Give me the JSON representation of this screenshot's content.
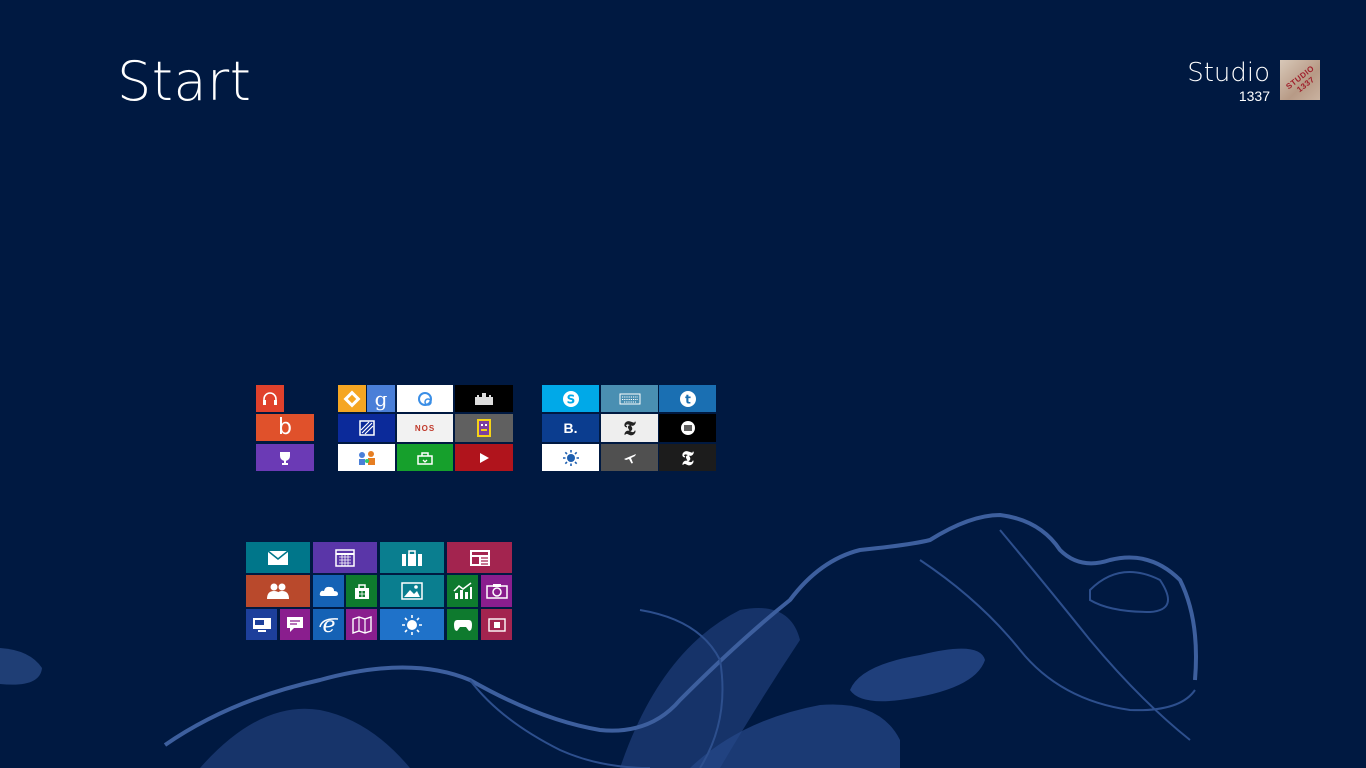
{
  "start": {
    "title": "Start"
  },
  "user": {
    "name": "Studio",
    "sub": "1337",
    "avatar_text": "STUDIO 1337"
  },
  "tile_glyphs": {
    "bing": "b",
    "gmail": "g",
    "booking": "B.",
    "nyt": "𝕿",
    "tumblr": "t",
    "nos": "NOS"
  },
  "colors": {
    "background": "#001941",
    "accent_wave": "#3d5f9e",
    "music": "#e0412c",
    "bing": "#e0512b",
    "games_hub": "#6b3ab5",
    "mail": "#00768a",
    "people": "#b9492c",
    "xbox": "#0e7a2e",
    "youtube": "#b0141c"
  },
  "icons": [
    "headphones-icon",
    "bing-icon",
    "trophy-icon",
    "google-maps-icon",
    "google-icon",
    "circle-icon",
    "castle-icon",
    "stripe-icon",
    "nos-icon",
    "robot-icon",
    "family-icon",
    "store-bag-icon",
    "play-icon",
    "skype-icon",
    "keyboard-icon",
    "tumblr-icon",
    "booking-icon",
    "nyt-icon",
    "news-circle-icon",
    "sun-icon",
    "plane-icon",
    "mail-icon",
    "calendar-icon",
    "travel-icon",
    "news-icon",
    "people-icon",
    "cloud-icon",
    "store-icon",
    "photos-icon",
    "finance-icon",
    "camera-icon",
    "desktop-icon",
    "messaging-icon",
    "ie-icon",
    "maps-icon",
    "weather-icon",
    "games-icon",
    "video-icon"
  ]
}
